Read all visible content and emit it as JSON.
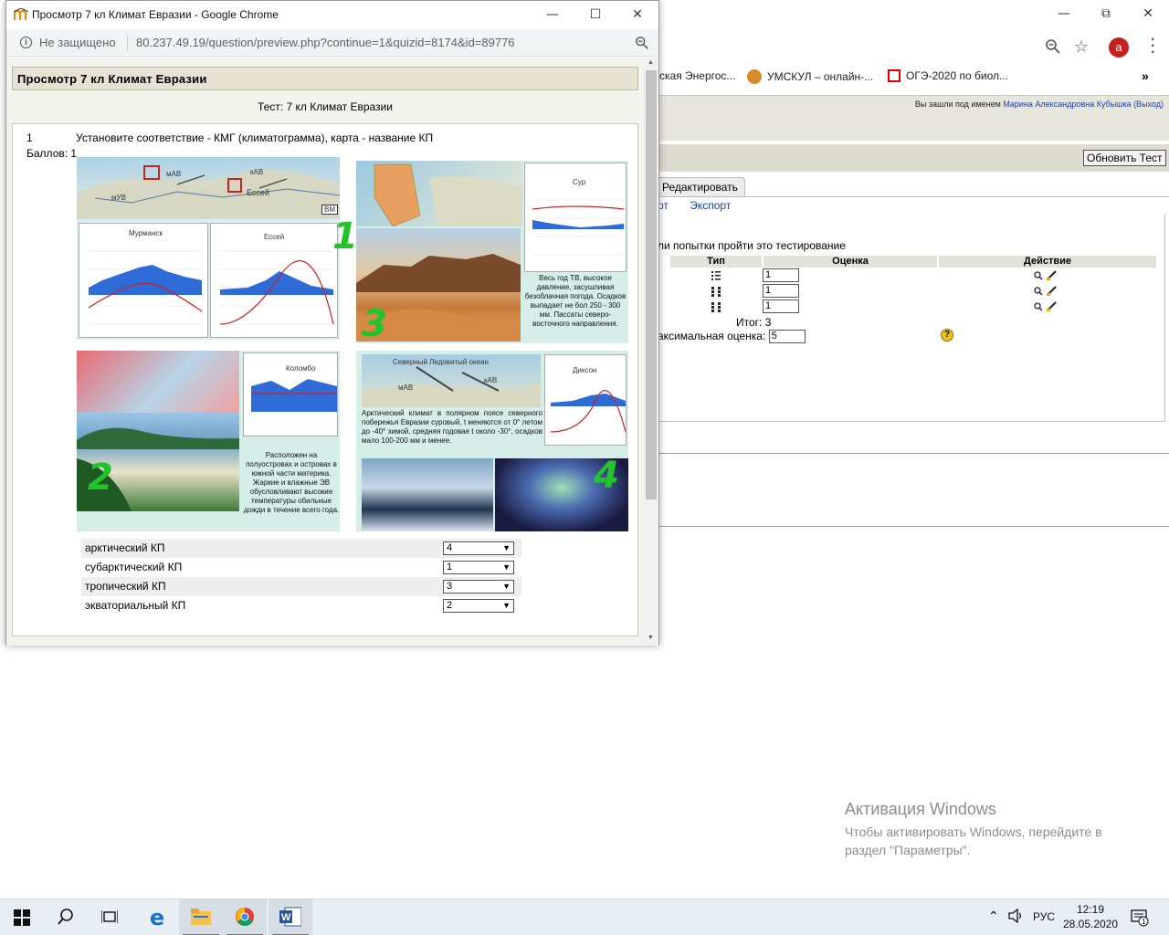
{
  "popup": {
    "window_title": "Просмотр 7 кл Климат Евразии - Google Chrome",
    "not_secure": "Не защищено",
    "url": "80.237.49.19/question/preview.php?continue=1&quizid=8174&id=89776",
    "heading": "Просмотр 7 кл Климат Евразии",
    "test_name": "Тест: 7 кл Климат Евразии",
    "question": {
      "number": "1",
      "points": "Баллов: 1",
      "text": "Установите соответствие - КМГ (климатограмма), карта - название КП"
    },
    "image": {
      "labels": {
        "murmansk": "Мурманск",
        "essey": "Ессей",
        "sur": "Сур",
        "colombo": "Коломбо",
        "dikson": "Диксон",
        "vm": "ВМ",
        "mav": "мАВ",
        "kav": "кАВ",
        "uv": "мУВ",
        "essey_map": "Ессей",
        "arctic_ocean": "Северный Ледовитый океан"
      },
      "numbers": [
        "1",
        "2",
        "3",
        "4"
      ],
      "desc_tropic": "Весь год ТВ, высокое давление, засушливая безоблачная погода. Осадков выпадает не бол 250 - 300 мм. Пассаты северо-восточного направления.",
      "desc_equatorial": "Расположен на полуостровах и островах в южной части материка. Жаркие и влажные ЭВ обусловливают высокие температуры обильные дожди в течение всего года.",
      "desc_arctic": "Арктический климат в полярном поясе северного побережья Евразии суровый, t меняются от 0° летом до -40° зимой, средняя годовая t около -30°, осадков мало 100-200 мм и менее."
    },
    "matches": [
      {
        "label": "арктический КП",
        "value": "4"
      },
      {
        "label": "субарктический КП",
        "value": "1"
      },
      {
        "label": "тропический КП",
        "value": "3"
      },
      {
        "label": "экваториальный КП",
        "value": "2"
      }
    ]
  },
  "background": {
    "bookmarks": [
      {
        "label": "ская Энергос..."
      },
      {
        "label": "УМСКУЛ – онлайн-..."
      },
      {
        "label": "ОГЭ-2020 по биол..."
      }
    ],
    "avatar_letter": "а",
    "logged_in_prefix": "Вы зашли под именем",
    "logged_in_user": "Марина Александровна Кубышка",
    "logout": "(Выход)",
    "refresh_button": "Обновить Тест",
    "edit_tab": "Редактировать",
    "sub_link_1": "рт",
    "sub_link_2": "Экспорт",
    "attempts_text": "ли попытки пройти это тестирование",
    "table_headers": {
      "type": "Тип",
      "grade": "Оценка",
      "action": "Действие"
    },
    "grades": [
      "1",
      "1",
      "1"
    ],
    "total": "Итог: 3",
    "max_grade_label": "аксимальная оценка:",
    "max_grade_value": "5"
  },
  "activation": {
    "title": "Активация Windows",
    "text": "Чтобы активировать Windows, перейдите в раздел \"Параметры\"."
  },
  "taskbar": {
    "lang": "РУС",
    "time": "12:19",
    "date": "28.05.2020",
    "notifications": "1"
  }
}
